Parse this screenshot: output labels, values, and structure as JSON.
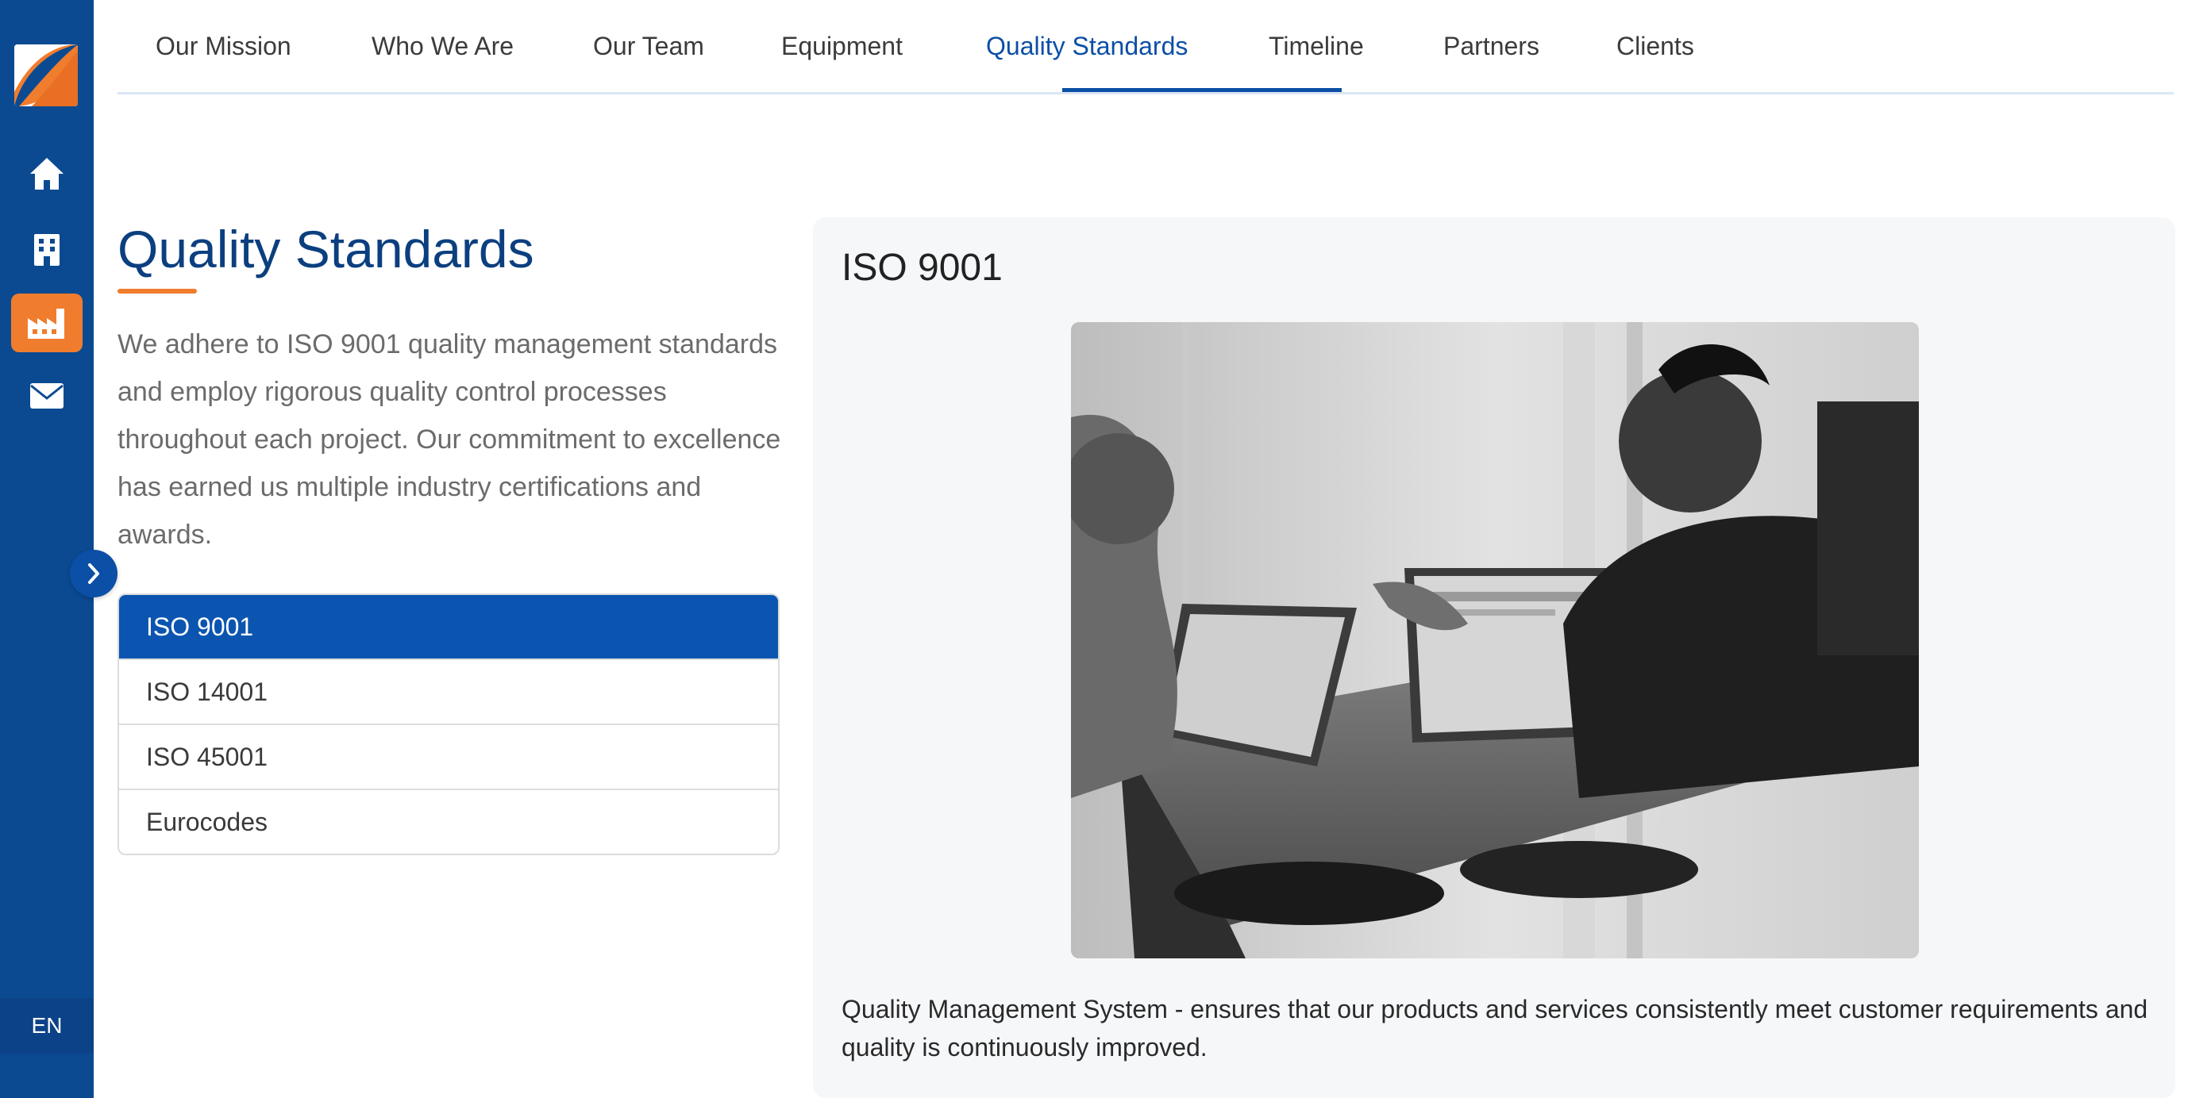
{
  "sidebar": {
    "logo_icon": "brand-leaf-logo",
    "items": [
      {
        "name": "home",
        "icon": "home-icon",
        "active": false
      },
      {
        "name": "building",
        "icon": "building-icon",
        "active": false
      },
      {
        "name": "factory",
        "icon": "factory-icon",
        "active": true
      },
      {
        "name": "mail",
        "icon": "mail-icon",
        "active": false
      }
    ],
    "language": "EN",
    "expand_icon": "chevron-right-icon"
  },
  "tabs": [
    {
      "label": "Our Mission",
      "active": false
    },
    {
      "label": "Who We Are",
      "active": false
    },
    {
      "label": "Our Team",
      "active": false
    },
    {
      "label": "Equipment",
      "active": false
    },
    {
      "label": "Quality Standards",
      "active": true
    },
    {
      "label": "Timeline",
      "active": false
    },
    {
      "label": "Partners",
      "active": false
    },
    {
      "label": "Clients",
      "active": false
    }
  ],
  "content": {
    "title": "Quality Standards",
    "intro": "We adhere to ISO 9001 quality management standards and employ rigorous quality control processes throughout each project. Our commitment to excellence has earned us multiple industry certifications and awards.",
    "standards": [
      {
        "label": "ISO 9001",
        "active": true
      },
      {
        "label": "ISO 14001",
        "active": false
      },
      {
        "label": "ISO 45001",
        "active": false
      },
      {
        "label": "Eurocodes",
        "active": false
      }
    ]
  },
  "detail": {
    "title": "ISO 9001",
    "description": "Quality Management System - ensures that our products and services consistently meet customer requirements and quality is continuously improved."
  },
  "colors": {
    "sidebar": "#0b4a91",
    "accent": "#f07c2e",
    "primary": "#0b55b0",
    "title": "#0b3f7f"
  }
}
